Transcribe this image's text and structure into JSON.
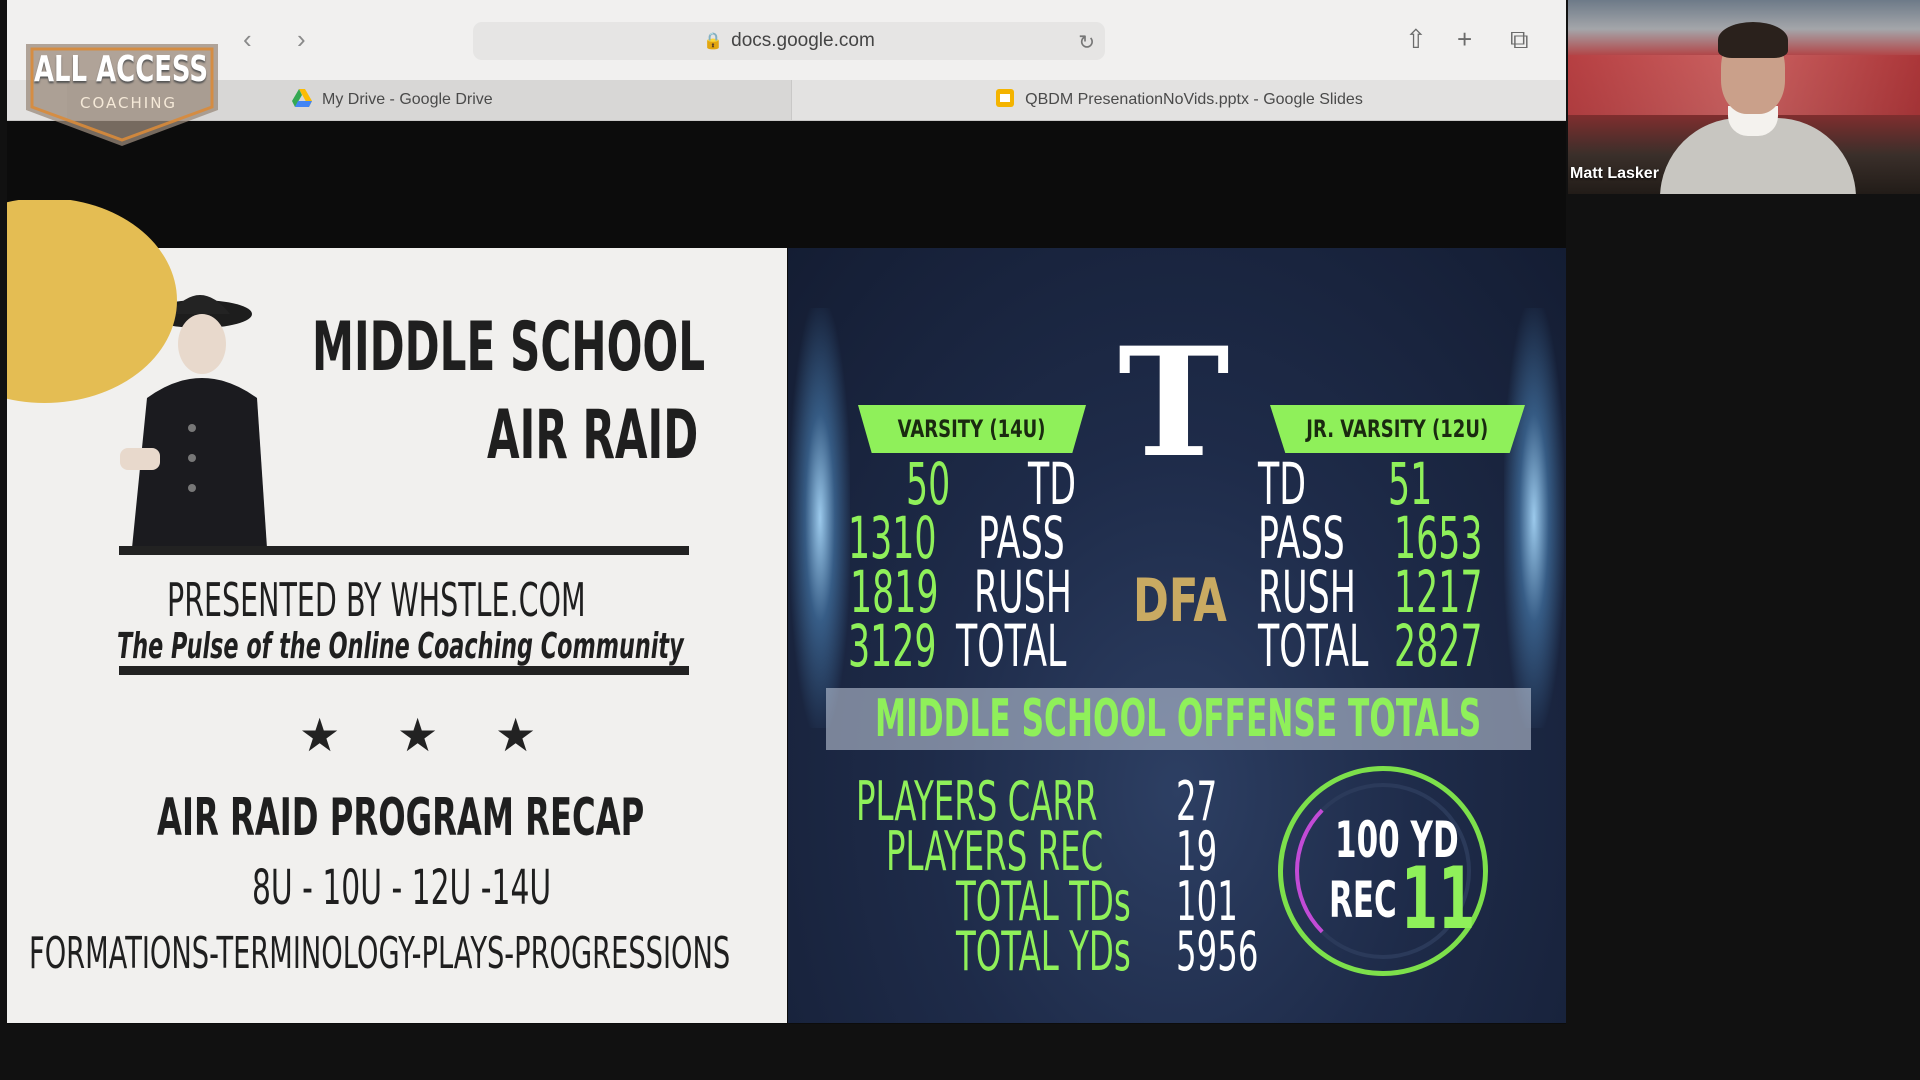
{
  "browser": {
    "address": "docs.google.com",
    "tabs": [
      {
        "label": "My Drive - Google Drive",
        "icon": "google-drive-icon"
      },
      {
        "label": "QBDM PresenationNoVids.pptx - Google Slides",
        "icon": "google-slides-icon"
      }
    ]
  },
  "watermark": {
    "line1": "ALL ACCESS",
    "line2": "COACHING"
  },
  "video": {
    "participant": "Matt Lasker"
  },
  "slide": {
    "left": {
      "title_line1": "MIDDLE SCHOOL",
      "title_line2": "AIR RAID",
      "presented_by": "PRESENTED BY WHSTLE.COM",
      "tagline": "The Pulse of the Online Coaching Community",
      "stars": "★ ★ ★",
      "recap": "AIR RAID PROGRAM RECAP",
      "ages": "8U - 10U - 12U -14U",
      "topics": "FORMATIONS-TERMINOLOGY-PLAYS-PROGRESSIONS"
    },
    "right": {
      "logo_letter": "T",
      "center_text": "DFA",
      "varsity": {
        "banner": "VARSITY (14U)",
        "rows": [
          {
            "value": "50",
            "label": "TD"
          },
          {
            "value": "1310",
            "label": "PASS"
          },
          {
            "value": "1819",
            "label": "RUSH"
          },
          {
            "value": "3129",
            "label": "TOTAL"
          }
        ]
      },
      "jv": {
        "banner": "JR. VARSITY (12U)",
        "rows": [
          {
            "label": "TD",
            "value": "51"
          },
          {
            "label": "PASS",
            "value": "1653"
          },
          {
            "label": "RUSH",
            "value": "1217"
          },
          {
            "label": "TOTAL",
            "value": "2827"
          }
        ]
      },
      "offense_title": "MIDDLE SCHOOL OFFENSE TOTALS",
      "offense_rows": [
        {
          "label": "PLAYERS CARR",
          "value": "27"
        },
        {
          "label": "PLAYERS REC",
          "value": "19"
        },
        {
          "label": "TOTAL TDs",
          "value": "101"
        },
        {
          "label": "TOTAL YDs",
          "value": "5956"
        }
      ],
      "ring": {
        "line1": "100 YD",
        "line2": "REC",
        "count": "11"
      }
    }
  }
}
